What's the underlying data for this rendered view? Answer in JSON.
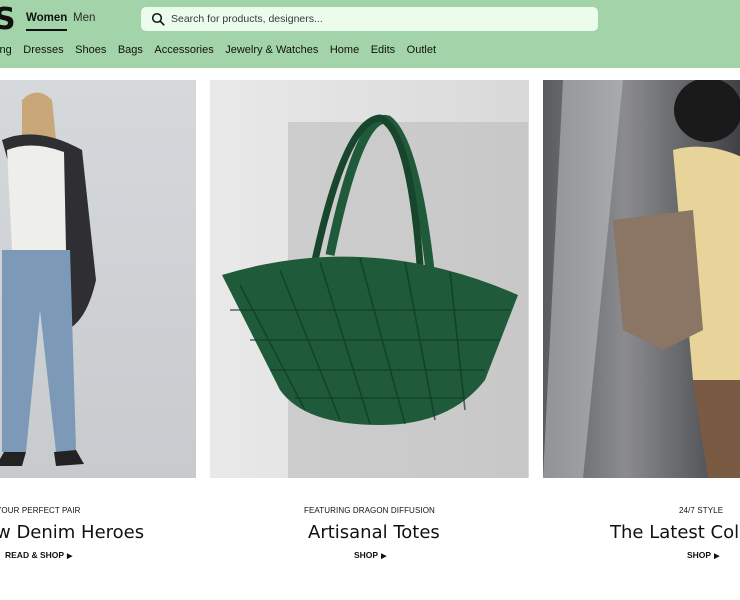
{
  "header": {
    "logo": "S",
    "tabs": [
      {
        "label": "Women",
        "active": true
      },
      {
        "label": "Men",
        "active": false
      }
    ],
    "search": {
      "placeholder": "Search for products, designers..."
    },
    "nav": [
      "hing",
      "Dresses",
      "Shoes",
      "Bags",
      "Accessories",
      "Jewelry & Watches",
      "Home",
      "Edits",
      "Outlet"
    ]
  },
  "cards": [
    {
      "eyebrow": "YOUR PERFECT PAIR",
      "title": "w Denim Heroes",
      "cta": "READ & SHOP"
    },
    {
      "eyebrow": "FEATURING DRAGON DIFFUSION",
      "title": "Artisanal Totes",
      "cta": "SHOP"
    },
    {
      "eyebrow": "24/7 STYLE",
      "title": "The Latest Colle",
      "cta": "SHOP"
    }
  ],
  "colors": {
    "header_bg": "#a3d4a9",
    "search_bg": "#ecfcec",
    "tote_green": "#1f5b3a"
  }
}
